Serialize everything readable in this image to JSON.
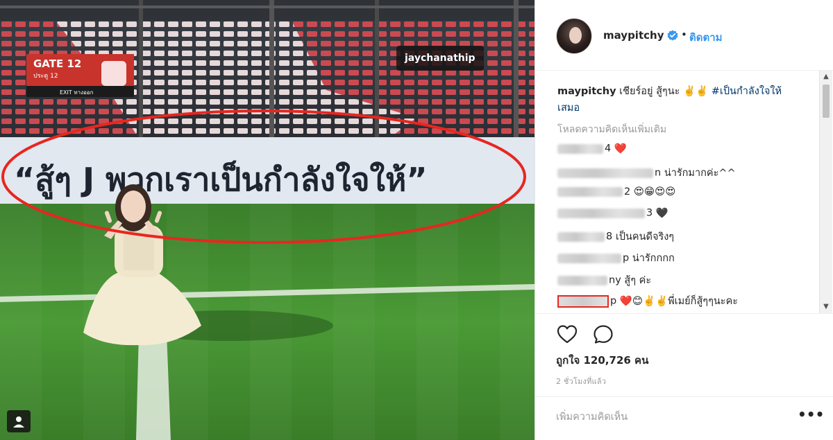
{
  "media": {
    "tag_label": "jaychanathip",
    "banner_text": "“สู้ๆ J พวกเราเป็นกำลังใจให้”",
    "gate_sign": "GATE 12",
    "gate_sub": "ประตู 12",
    "gate_sub2": "EXIT ทางออก",
    "user_tag_icon": "person-tag-icon"
  },
  "header": {
    "username": "maypitchy",
    "verified_icon": "verified-badge-icon",
    "dot": "•",
    "follow_label": "ติดตาม"
  },
  "caption": {
    "user": "maypitchy",
    "text": " เชียร์อยู่ สู้ๆนะ ✌️✌️ ",
    "hashtag": "#เป็นกำลังใจให้เสมอ"
  },
  "load_more": "โหลดความคิดเห็นเพิ่มเติม",
  "comments": [
    {
      "name_tail": "4",
      "text": "❤️"
    },
    {
      "name_tail": "n",
      "text": "น่ารักมากค่ะ^^"
    },
    {
      "name_tail": "2",
      "text": "😍😁😍😍"
    },
    {
      "name_tail": "3",
      "text": "🖤"
    },
    {
      "name_tail": "8",
      "text": "เป็นคนดีจริงๆ"
    },
    {
      "name_tail": "p",
      "text": "น่ารักกกก"
    },
    {
      "name_tail": "ny",
      "text": "สู้ๆ ค่ะ"
    },
    {
      "name_tail": "p",
      "text": "❤️😊✌️✌️พี่เมย์ก็สู้ๆๆนะคะ"
    }
  ],
  "actions": {
    "like_icon": "heart-icon",
    "comment_icon": "comment-bubble-icon",
    "likes_text": "ถูกใจ 120,726 คน",
    "timestamp": "2 ชั่วโมงที่แล้ว"
  },
  "add_comment": {
    "placeholder": "เพิ่มความคิดเห็น",
    "more_label": "•••"
  },
  "colors": {
    "link_blue": "#3897f0",
    "hashtag_blue": "#003569",
    "annotation_red": "#e8261f",
    "grass": "#3f8a2c"
  }
}
